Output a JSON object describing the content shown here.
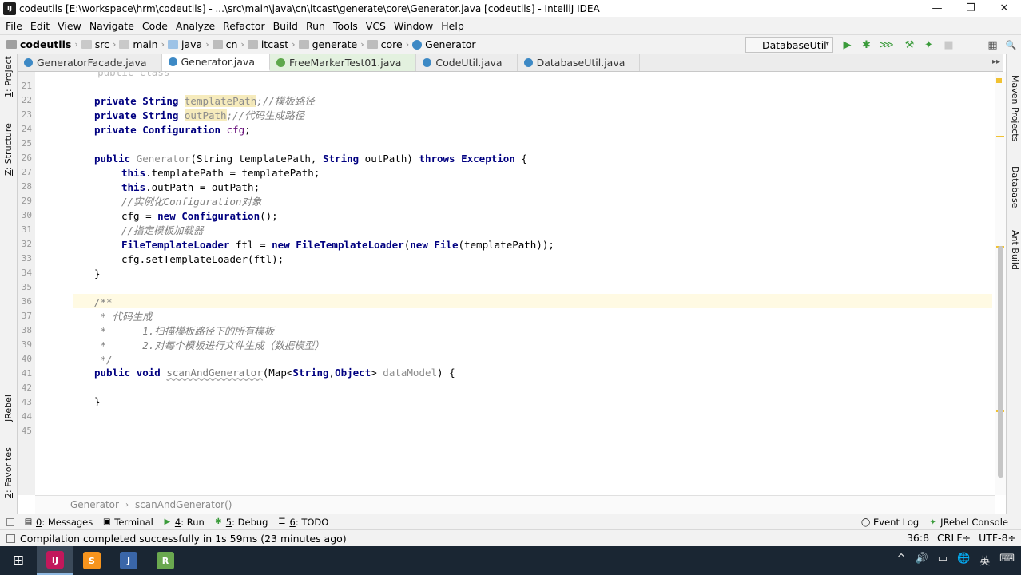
{
  "window": {
    "title": "codeutils [E:\\workspace\\hrm\\codeutils] - ...\\src\\main\\java\\cn\\itcast\\generate\\core\\Generator.java [codeutils] - IntelliJ IDEA",
    "app_icon": "IJ",
    "minimize": "—",
    "maximize": "❐",
    "close": "✕"
  },
  "menu": [
    "File",
    "Edit",
    "View",
    "Navigate",
    "Code",
    "Analyze",
    "Refactor",
    "Build",
    "Run",
    "Tools",
    "VCS",
    "Window",
    "Help"
  ],
  "navbar": {
    "crumbs": [
      "codeutils",
      "src",
      "main",
      "java",
      "cn",
      "itcast",
      "generate",
      "core",
      "Generator"
    ],
    "separator": "›",
    "run_config": "DatabaseUtil",
    "run_config_arrow": "▾"
  },
  "toolbar_icons": {
    "run": "▶",
    "debug": "✱",
    "coverage": "⋙",
    "build": "⚒",
    "rebel": "✦",
    "stop": "■",
    "structure": "▦",
    "search": "🔍"
  },
  "tabs": [
    {
      "label": "GeneratorFacade.java",
      "state": "normal"
    },
    {
      "label": "Generator.java",
      "state": "active"
    },
    {
      "label": "FreeMarkerTest01.java",
      "state": "green"
    },
    {
      "label": "CodeUtil.java",
      "state": "normal"
    },
    {
      "label": "DatabaseUtil.java",
      "state": "normal"
    }
  ],
  "tabs_overflow": "▸▸",
  "left_tool_tabs": [
    {
      "num": "1",
      "label": ": Project"
    },
    {
      "num": "Z",
      "label": ": Structure"
    },
    {
      "num": "",
      "label": "JRebel"
    },
    {
      "num": "2",
      "label": ": Favorites"
    }
  ],
  "right_tool_tabs": [
    "Maven Projects",
    "Database",
    "Ant Build"
  ],
  "editor": {
    "line_numbers": [
      "21",
      "22",
      "23",
      "24",
      "25",
      "26",
      "27",
      "28",
      "29",
      "30",
      "31",
      "32",
      "33",
      "34",
      "35",
      "36",
      "37",
      "38",
      "39",
      "40",
      "41",
      "42",
      "43",
      "44",
      "45"
    ],
    "lines": {
      "l21": "    public class",
      "l22": {
        "kw1": "private",
        "kw2": "String",
        "field": "templatePath",
        "comment": ";//模板路径"
      },
      "l23": {
        "kw1": "private",
        "kw2": "String",
        "field": "outPath",
        "comment": ";//代码生成路径"
      },
      "l24": {
        "kw1": "private",
        "kw2": "Configuration",
        "field": "cfg",
        "end": ";"
      },
      "l26": {
        "kw1": "public",
        "name": "Generator",
        "p1": "(String templatePath, ",
        "kw3": "String",
        "p2": " outPath) ",
        "kw4": "throws",
        "kw5": "Exception",
        "end": " {"
      },
      "l27": {
        "kw": "this",
        "rest": ".templatePath = templatePath;"
      },
      "l28": {
        "kw": "this",
        "rest": ".outPath = outPath;"
      },
      "l29": "//实例化Configuration对象",
      "l30": {
        "pre": "cfg = ",
        "kw": "new",
        "cls": "Configuration",
        "end": "();"
      },
      "l31": "//指定模板加载器",
      "l32": {
        "cls": "FileTemplateLoader",
        "var": " ftl = ",
        "kw": "new",
        "cls2": " FileTemplateLoader",
        "p": "(",
        "kw2": "new",
        "cls3": " File",
        "arg": "(templatePath));"
      },
      "l33": "cfg.setTemplateLoader(ftl);",
      "l34": "}",
      "l36": "/**",
      "l37": " * 代码生成",
      "l38": " *      1.扫描模板路径下的所有模板",
      "l39": " *      2.对每个模板进行文件生成（数据模型）",
      "l40": " */",
      "l41": {
        "kw1": "public",
        "kw2": "void",
        "name": "scanAndGenerator",
        "p1": "(Map<",
        "t1": "String",
        "p2": ",",
        "t2": "Object",
        "p3": "> ",
        "param": "dataModel",
        "end": ") {"
      },
      "l43": "}",
      "l44": "}"
    },
    "bulb_icon": "💡"
  },
  "breadcrumb_footer": {
    "class": "Generator",
    "sep": "›",
    "method": "scanAndGenerator()"
  },
  "tool_windows": [
    {
      "icon": "▤",
      "num": "0",
      "label": ": Messages"
    },
    {
      "icon": "▣",
      "num": "",
      "label": "Terminal"
    },
    {
      "icon": "▶",
      "num": "4",
      "label": ": Run"
    },
    {
      "icon": "✱",
      "num": "5",
      "label": ": Debug"
    },
    {
      "icon": "☰",
      "num": "6",
      "label": ": TODO"
    }
  ],
  "tool_windows_right": [
    {
      "icon": "◯",
      "label": "Event Log"
    },
    {
      "icon": "✦",
      "label": "JRebel Console"
    }
  ],
  "status": {
    "message": "Compilation completed successfully in 1s 59ms (23 minutes ago)",
    "position": "36:8",
    "line_sep": "CRLF÷",
    "encoding": "UTF-8÷"
  },
  "taskbar": {
    "start": "⊞",
    "apps": [
      {
        "label": "IJ",
        "color": "#c2185b"
      },
      {
        "label": "S",
        "color": "#f7941d"
      },
      {
        "label": "J",
        "color": "#3a66a8"
      },
      {
        "label": "R",
        "color": "#6aa84f"
      }
    ],
    "tray": [
      "^",
      "🔊",
      "▭",
      "🌐",
      "英",
      "⌨"
    ]
  }
}
